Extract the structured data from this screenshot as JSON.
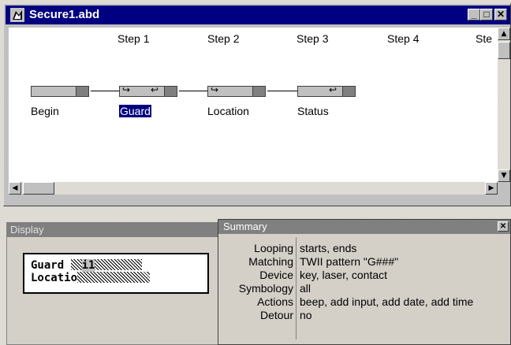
{
  "window": {
    "title": "Secure1.abd",
    "min_glyph": "_",
    "max_glyph": "□",
    "close_glyph": "✕"
  },
  "steps": [
    "Step 1",
    "Step 2",
    "Step 3",
    "Step 4",
    "Ste"
  ],
  "nodes": [
    {
      "label": "Begin",
      "selected": false
    },
    {
      "label": "Guard",
      "selected": true
    },
    {
      "label": "Location",
      "selected": false
    },
    {
      "label": "Status",
      "selected": false
    }
  ],
  "display_panel": {
    "title": "Display",
    "lines": [
      {
        "label": "Guard ",
        "value": "i1"
      },
      {
        "label": "Locatio",
        "value": ""
      }
    ]
  },
  "summary": {
    "title": "Summary",
    "close_glyph": "✕",
    "rows": [
      {
        "key": "Looping",
        "value": "starts, ends"
      },
      {
        "key": "Matching",
        "value": "TWII pattern \"G###\""
      },
      {
        "key": "Device",
        "value": "key, laser, contact"
      },
      {
        "key": "Symbology",
        "value": "all"
      },
      {
        "key": "Actions",
        "value": "beep, add input, add date, add time"
      },
      {
        "key": "Detour",
        "value": "no"
      }
    ]
  },
  "colors": {
    "title_active": "#000080",
    "title_inactive": "#808080",
    "selection": "#000080"
  },
  "icons": [
    "app-icon",
    "minimize-icon",
    "maximize-icon",
    "close-icon",
    "scroll-up-icon",
    "scroll-down-icon",
    "scroll-left-icon",
    "scroll-right-icon"
  ]
}
